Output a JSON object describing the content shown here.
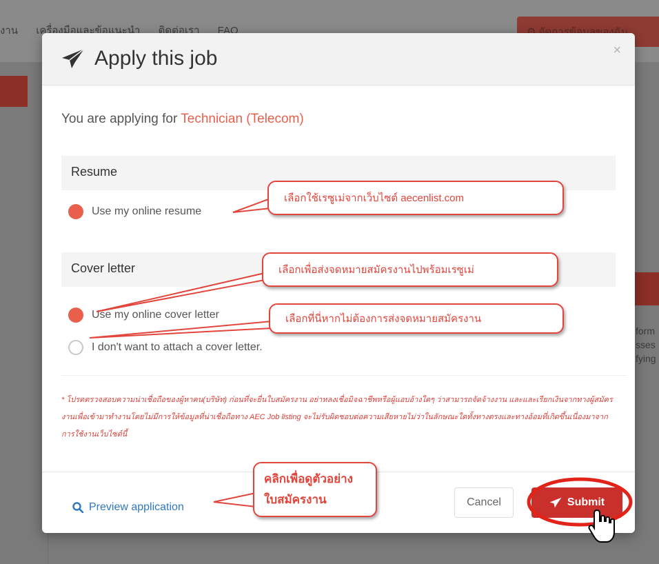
{
  "background": {
    "nav_items": [
      "งาน",
      "เครื่องมือและข้อแนะนำ",
      "ติดต่อเรา",
      "FAQ"
    ],
    "account_button": "จัดการข้อมูลของฉัน",
    "right_text": [
      "form",
      "sses",
      "fying"
    ]
  },
  "modal": {
    "title": "Apply this job",
    "close_label": "×",
    "applying_prefix": "You are applying for",
    "job_title": "Technician (Telecom)",
    "resume": {
      "heading": "Resume",
      "option": "Use my online resume"
    },
    "cover_letter": {
      "heading": "Cover letter",
      "option_online": "Use my online cover letter",
      "option_none": "I don't want to attach a cover letter."
    },
    "disclaimer": "* โปรดตรวจสอบความน่าเชื่อถือของผู้หาคน(บริษัท) ก่อนที่จะยื่นใบสมัครงาน อย่าหลงเชื่อมิจฉาชีพหรือผู้แอบอ้างใดๆ ว่าสามารถจัดจ้างงาน และและเรียกเงินจากทางผู้สมัครงานเพื่อเข้ามาทำงานโดยไม่มีการให้ข้อมูลที่น่าเชื่อถือทาง AEC Job listing จะไม่รับผิดชอบต่อความเสียหายไม่ว่าในลักษณะใดทั้งทางตรงและทางอ้อมที่เกิดขึ้นเนื่องมาจากการใช้งานเว็บไซต์นี้",
    "footer": {
      "preview": "Preview application",
      "cancel": "Cancel",
      "submit": "Submit"
    }
  },
  "annotations": {
    "resume_note": "เลือกใช้เรซูเม่จากเว็บไซต์ aecenlist.com",
    "cover_note": "เลือกเพื่อส่งจดหมายสมัครงานไปพร้อมเรซูเม่",
    "nocover_note": "เลือกที่นี่หากไม่ต้องการส่งจดหมายสมัครงาน",
    "preview_note_line1": "คลิกเพื่อดูตัวอย่าง",
    "preview_note_line2": "ใบสมัครงาน"
  },
  "colors": {
    "accent": "#e8604c",
    "submit": "#c9302c",
    "link": "#2f78c4",
    "annotation": "#e2453c"
  }
}
